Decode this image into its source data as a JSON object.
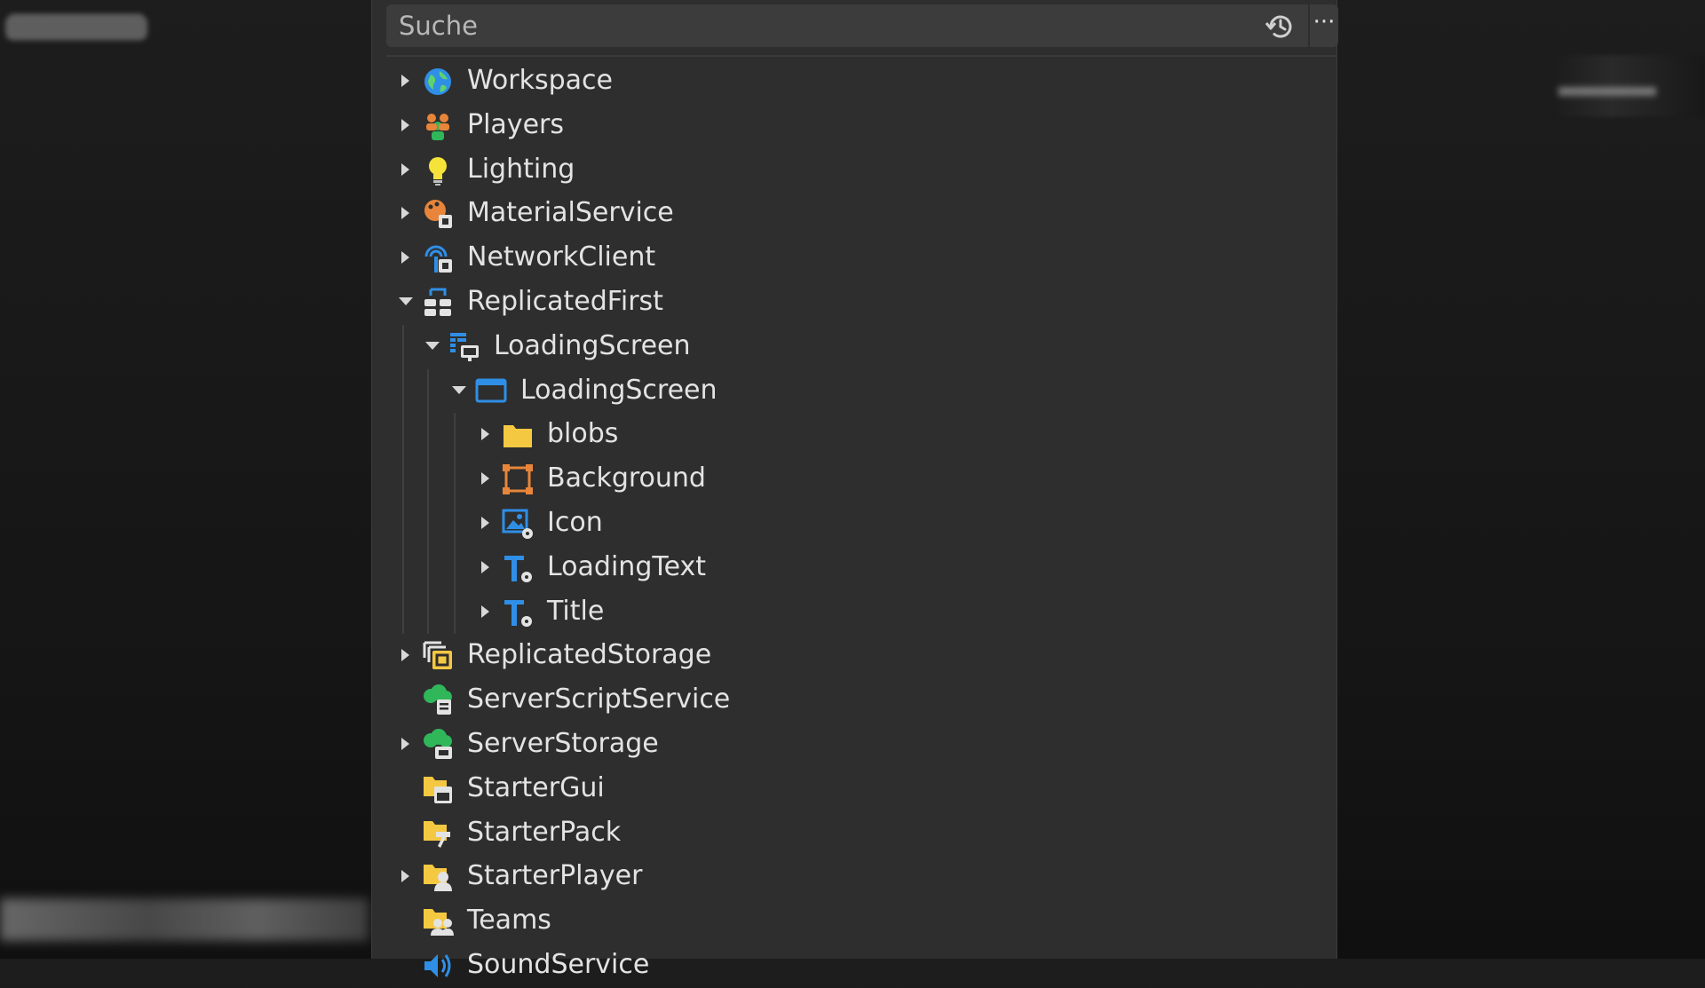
{
  "search": {
    "placeholder": "Suche"
  },
  "toolbar": {
    "more_label": "···"
  },
  "tree": [
    {
      "label": "Workspace",
      "icon": "workspace-globe-icon",
      "level": 0,
      "arrow": "collapsed"
    },
    {
      "label": "Players",
      "icon": "players-icon",
      "level": 0,
      "arrow": "collapsed"
    },
    {
      "label": "Lighting",
      "icon": "lightbulb-icon",
      "level": 0,
      "arrow": "collapsed"
    },
    {
      "label": "MaterialService",
      "icon": "material-service-icon",
      "level": 0,
      "arrow": "collapsed"
    },
    {
      "label": "NetworkClient",
      "icon": "network-client-icon",
      "level": 0,
      "arrow": "collapsed"
    },
    {
      "label": "ReplicatedFirst",
      "icon": "replicated-first-icon",
      "level": 0,
      "arrow": "expanded"
    },
    {
      "label": "LoadingScreen",
      "icon": "screen-gui-icon",
      "level": 1,
      "arrow": "expanded"
    },
    {
      "label": "LoadingScreen",
      "icon": "frame-icon",
      "level": 2,
      "arrow": "expanded"
    },
    {
      "label": "blobs",
      "icon": "folder-icon",
      "level": 3,
      "arrow": "collapsed"
    },
    {
      "label": "Background",
      "icon": "frame-selection-icon",
      "level": 3,
      "arrow": "collapsed"
    },
    {
      "label": "Icon",
      "icon": "image-label-icon",
      "level": 3,
      "arrow": "collapsed"
    },
    {
      "label": "LoadingText",
      "icon": "text-label-icon",
      "level": 3,
      "arrow": "collapsed"
    },
    {
      "label": "Title",
      "icon": "text-label-icon",
      "level": 3,
      "arrow": "collapsed"
    },
    {
      "label": "ReplicatedStorage",
      "icon": "replicated-storage-icon",
      "level": 0,
      "arrow": "collapsed"
    },
    {
      "label": "ServerScriptService",
      "icon": "server-script-service-icon",
      "level": 0,
      "arrow": "none"
    },
    {
      "label": "ServerStorage",
      "icon": "server-storage-icon",
      "level": 0,
      "arrow": "collapsed"
    },
    {
      "label": "StarterGui",
      "icon": "starter-gui-icon",
      "level": 0,
      "arrow": "none"
    },
    {
      "label": "StarterPack",
      "icon": "starter-pack-icon",
      "level": 0,
      "arrow": "none"
    },
    {
      "label": "StarterPlayer",
      "icon": "starter-player-icon",
      "level": 0,
      "arrow": "collapsed"
    },
    {
      "label": "Teams",
      "icon": "teams-icon",
      "level": 0,
      "arrow": "none"
    },
    {
      "label": "SoundService",
      "icon": "sound-service-icon",
      "level": 0,
      "arrow": "none"
    }
  ],
  "colors": {
    "panel_bg": "#2e2e2e",
    "search_bg": "#3c3c3c",
    "text": "#e3e3e3",
    "blue": "#2f8fe6",
    "orange": "#e8853a",
    "yellow": "#f5c842",
    "green": "#2fb75a"
  }
}
